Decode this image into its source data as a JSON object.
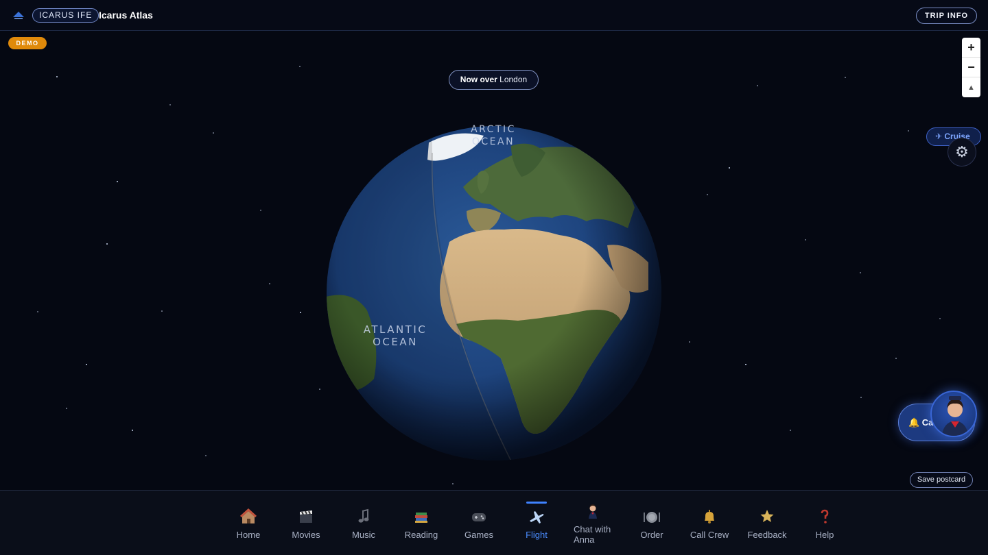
{
  "header": {
    "brand_pill": "ICARUS IFE",
    "title": "Icarus Atlas",
    "trip_info_label": "TRIP INFO"
  },
  "demo_badge": "DEMO",
  "map": {
    "now_over_prefix": "Now over",
    "now_over_place": "London",
    "zoom_in": "+",
    "zoom_out": "−",
    "reset_north": "▲",
    "flight_phase": "✈ Cruise",
    "ocean_labels": {
      "arctic_line1": "ARCTIC",
      "arctic_line2": "OCEAN",
      "atlantic_line1": "ATLANTIC",
      "atlantic_line2": "OCEAN"
    },
    "settings_icon": "gear-icon"
  },
  "call_crew_float": "🔔 Call Crew",
  "save_postcard": "Save postcard",
  "nav": {
    "items": [
      {
        "label": "Home",
        "icon": "home-icon"
      },
      {
        "label": "Movies",
        "icon": "clapperboard-icon"
      },
      {
        "label": "Music",
        "icon": "music-note-icon"
      },
      {
        "label": "Reading",
        "icon": "books-icon"
      },
      {
        "label": "Games",
        "icon": "gamepad-icon"
      },
      {
        "label": "Flight",
        "icon": "airplane-icon",
        "active": true
      },
      {
        "label": "Chat with Anna",
        "icon": "flight-attendant-icon"
      },
      {
        "label": "Order",
        "icon": "plate-icon"
      },
      {
        "label": "Call Crew",
        "icon": "bell-icon"
      },
      {
        "label": "Feedback",
        "icon": "star-icon"
      },
      {
        "label": "Help",
        "icon": "question-icon"
      }
    ]
  },
  "colors": {
    "background": "#050812",
    "accent": "#3f82ff",
    "demo": "#e08a0b"
  }
}
